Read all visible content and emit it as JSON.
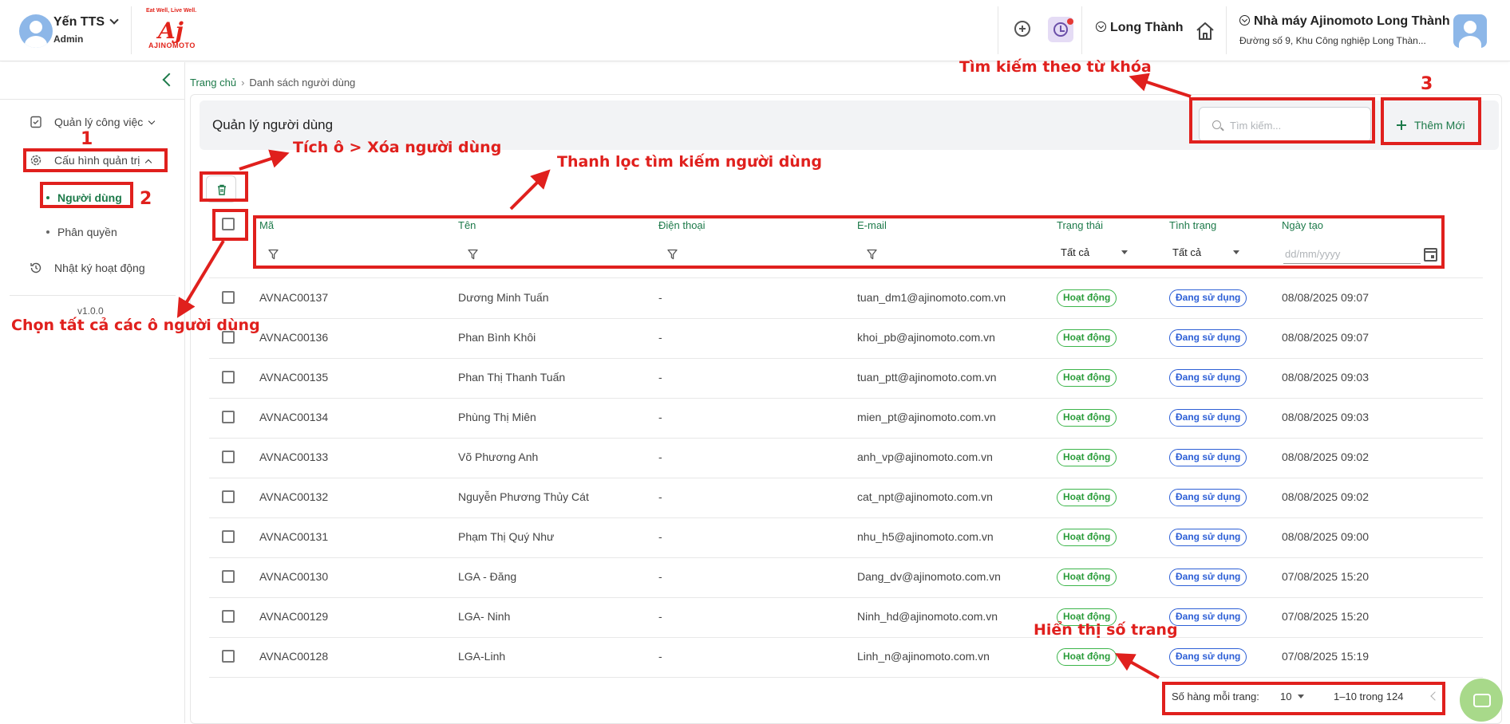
{
  "header": {
    "user_name": "Yến TTS",
    "user_role": "Admin",
    "logo_tagline": "Eat Well, Live Well.",
    "logo_mark": "Aj",
    "logo_name": "AJINOMOTO",
    "location": "Long Thành",
    "factory_name": "Nhà máy Ajinomoto Long Thành",
    "factory_address": "Đường số 9, Khu Công nghiệp Long Thàn..."
  },
  "sidebar": {
    "items": [
      {
        "label": "Quản lý công việc",
        "icon": "task-icon"
      },
      {
        "label": "Cấu hình quản trị",
        "icon": "gear-icon"
      },
      {
        "label": "Nhật ký hoạt động",
        "icon": "history-icon"
      }
    ],
    "subitems": [
      {
        "label": "Người dùng",
        "active": true
      },
      {
        "label": "Phân quyền",
        "active": false
      }
    ],
    "version": "v1.0.0"
  },
  "breadcrumb": {
    "home": "Trang chủ",
    "current": "Danh sách người dùng"
  },
  "page": {
    "title": "Quản lý người dùng",
    "search_placeholder": "Tìm kiếm...",
    "add_label": "Thêm Mới"
  },
  "table": {
    "columns": [
      "Mã",
      "Tên",
      "Điện thoại",
      "E-mail",
      "Trạng thái",
      "Tình trạng",
      "Ngày tạo"
    ],
    "filter_status": "Tất cả",
    "filter_condition": "Tất cả",
    "date_placeholder": "dd/mm/yyyy",
    "rows": [
      {
        "code": "AVNAC00137",
        "name": "Dương Minh Tuấn",
        "phone": "-",
        "email": "tuan_dm1@ajinomoto.com.vn",
        "status": "Hoạt động",
        "condition": "Đang sử dụng",
        "created": "08/08/2025 09:07"
      },
      {
        "code": "AVNAC00136",
        "name": "Phan Bình Khôi",
        "phone": "-",
        "email": "khoi_pb@ajinomoto.com.vn",
        "status": "Hoạt động",
        "condition": "Đang sử dụng",
        "created": "08/08/2025 09:07"
      },
      {
        "code": "AVNAC00135",
        "name": "Phan Thị Thanh Tuấn",
        "phone": "-",
        "email": "tuan_ptt@ajinomoto.com.vn",
        "status": "Hoạt động",
        "condition": "Đang sử dụng",
        "created": "08/08/2025 09:03"
      },
      {
        "code": "AVNAC00134",
        "name": "Phùng Thị Miên",
        "phone": "-",
        "email": "mien_pt@ajinomoto.com.vn",
        "status": "Hoạt động",
        "condition": "Đang sử dụng",
        "created": "08/08/2025 09:03"
      },
      {
        "code": "AVNAC00133",
        "name": "Võ Phương Anh",
        "phone": "-",
        "email": "anh_vp@ajinomoto.com.vn",
        "status": "Hoạt động",
        "condition": "Đang sử dụng",
        "created": "08/08/2025 09:02"
      },
      {
        "code": "AVNAC00132",
        "name": "Nguyễn Phương Thủy Cát",
        "phone": "-",
        "email": "cat_npt@ajinomoto.com.vn",
        "status": "Hoạt động",
        "condition": "Đang sử dụng",
        "created": "08/08/2025 09:02"
      },
      {
        "code": "AVNAC00131",
        "name": "Phạm Thị Quý Như",
        "phone": "-",
        "email": "nhu_h5@ajinomoto.com.vn",
        "status": "Hoạt động",
        "condition": "Đang sử dụng",
        "created": "08/08/2025 09:00"
      },
      {
        "code": "AVNAC00130",
        "name": "LGA - Đăng",
        "phone": "-",
        "email": "Dang_dv@ajinomoto.com.vn",
        "status": "Hoạt động",
        "condition": "Đang sử dụng",
        "created": "07/08/2025 15:20"
      },
      {
        "code": "AVNAC00129",
        "name": "LGA- Ninh",
        "phone": "-",
        "email": "Ninh_hd@ajinomoto.com.vn",
        "status": "Hoạt động",
        "condition": "Đang sử dụng",
        "created": "07/08/2025 15:20"
      },
      {
        "code": "AVNAC00128",
        "name": "LGA-Linh",
        "phone": "-",
        "email": "Linh_n@ajinomoto.com.vn",
        "status": "Hoạt động",
        "condition": "Đang sử dụng",
        "created": "07/08/2025 15:19"
      }
    ]
  },
  "pagination": {
    "rows_label": "Số hàng mỗi trang:",
    "rows_value": "10",
    "range": "1–10 trong 124"
  },
  "annotations": {
    "num1": "1",
    "num2": "2",
    "num3": "3",
    "search_note": "Tìm kiếm theo từ khóa",
    "delete_note": "Tích ô > Xóa người dùng",
    "filter_note": "Thanh lọc tìm kiếm người dùng",
    "select_all_note": "Chọn tất cả các ô người dùng",
    "pagination_note": "Hiển thị số trang"
  },
  "colors": {
    "accent": "#1d7a4a",
    "annotation": "#e0201d",
    "status_green": "#3bb54a",
    "condition_blue": "#2d5fd6"
  }
}
